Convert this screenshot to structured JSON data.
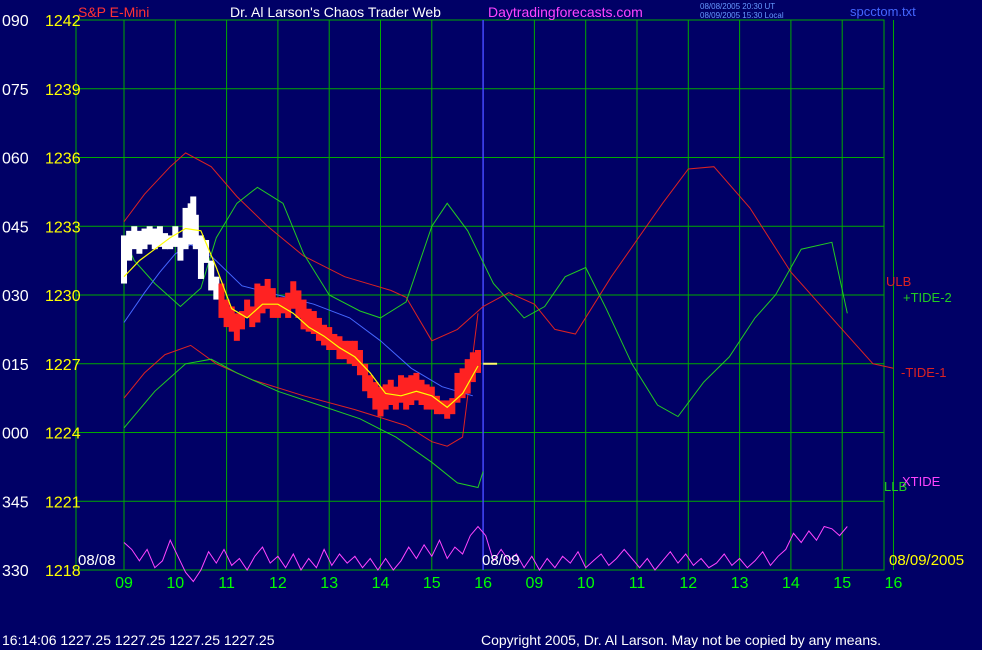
{
  "header": {
    "instrument": "S&P E-Mini",
    "title": "Dr. Al Larson's Chaos Trader Web",
    "site": "Daytradingforecasts.com",
    "timestamp_line1": "08/08/2005 20:30 UT",
    "timestamp_line2": "08/09/2005 15:30 Local",
    "filename": "spcctom.txt"
  },
  "status": {
    "time": "16:14:06",
    "ohlc": "1227.25 1227.25 1227.25 1227.25"
  },
  "copyright": "Copyright 2005, Dr. Al Larson. May not be copied by any means.",
  "colors": {
    "background": "#000066",
    "grid": "#00aa00",
    "price_tick": "#ffff00",
    "angle_tick": "#ffffff",
    "time_tick": "#00ff00",
    "title": "#ffffff",
    "instrument": "#ff3333",
    "site": "#ff44ff",
    "timestamp": "#6699ff",
    "ulb": "#dd2222",
    "tide2": "#22cc22",
    "tide1": "#dd2222",
    "xtide": "#ff44ff",
    "llb": "#22cc22",
    "price_bars": "#ff2222",
    "price_bars_early": "#ffffff",
    "moving_average": "#ffff00",
    "blue_line": "#4466ff",
    "date_marker": "#4444ff",
    "forecast_tick": "#ffff66"
  },
  "chart_data": {
    "type": "line",
    "yaxis_price": [
      "1242",
      "1239",
      "1236",
      "1233",
      "1230",
      "1227",
      "1224",
      "1221",
      "1218"
    ],
    "yaxis_angle": [
      "090",
      "075",
      "060",
      "045",
      "030",
      "015",
      "000",
      "345",
      "330"
    ],
    "price_range": [
      1218,
      1242
    ],
    "xaxis_hours": [
      "09",
      "10",
      "11",
      "12",
      "13",
      "14",
      "15",
      "16",
      "09",
      "10",
      "11",
      "12",
      "13",
      "14",
      "15",
      "16"
    ],
    "date_labels": [
      "08/08",
      "08/09",
      "08/09/2005"
    ],
    "grid": true,
    "series_labels": [
      "ULB",
      "+TIDE-2",
      "-TIDE-1",
      "XTIDE",
      "LLB"
    ],
    "ulb": [
      [
        0.0,
        1233.2
      ],
      [
        0.4,
        1234.4
      ],
      [
        0.9,
        1235.6
      ],
      [
        1.2,
        1236.2
      ],
      [
        1.7,
        1235.6
      ],
      [
        2.2,
        1234.3
      ],
      [
        2.8,
        1233.0
      ],
      [
        3.5,
        1231.7
      ],
      [
        4.3,
        1230.8
      ],
      [
        5.2,
        1230.2
      ],
      [
        5.5,
        1229.9
      ],
      [
        6.0,
        1228.0
      ],
      [
        6.5,
        1228.5
      ],
      [
        7.0,
        1229.5
      ],
      [
        7.5,
        1230.1
      ],
      [
        8.0,
        1229.6
      ],
      [
        8.4,
        1228.5
      ],
      [
        8.8,
        1228.3
      ],
      [
        9.5,
        1230.8
      ],
      [
        10.5,
        1234.0
      ],
      [
        11.0,
        1235.5
      ],
      [
        11.5,
        1235.6
      ],
      [
        12.2,
        1233.8
      ],
      [
        13.0,
        1231.0
      ],
      [
        14.0,
        1228.5
      ],
      [
        14.6,
        1227.0
      ],
      [
        15.0,
        1226.8
      ]
    ],
    "tide2": [
      [
        0.0,
        1232.5
      ],
      [
        0.2,
        1231.5
      ],
      [
        0.6,
        1230.5
      ],
      [
        1.1,
        1229.5
      ],
      [
        1.5,
        1230.3
      ],
      [
        1.8,
        1232.5
      ],
      [
        2.2,
        1234.0
      ],
      [
        2.6,
        1234.7
      ],
      [
        3.1,
        1234.0
      ],
      [
        3.5,
        1231.8
      ],
      [
        4.0,
        1230.0
      ],
      [
        4.6,
        1229.3
      ],
      [
        5.0,
        1229.0
      ],
      [
        5.5,
        1229.7
      ],
      [
        6.0,
        1233.0
      ],
      [
        6.3,
        1234.0
      ],
      [
        6.7,
        1232.8
      ],
      [
        7.2,
        1230.5
      ],
      [
        7.8,
        1229.0
      ],
      [
        8.2,
        1229.5
      ],
      [
        8.6,
        1230.8
      ],
      [
        9.0,
        1231.2
      ],
      [
        9.4,
        1229.4
      ],
      [
        9.9,
        1227.0
      ],
      [
        10.4,
        1225.2
      ],
      [
        10.8,
        1224.7
      ],
      [
        11.3,
        1226.2
      ],
      [
        11.8,
        1227.3
      ],
      [
        12.3,
        1229.0
      ],
      [
        12.7,
        1230.0
      ],
      [
        13.2,
        1232.0
      ],
      [
        13.8,
        1232.3
      ],
      [
        14.1,
        1229.2
      ]
    ],
    "tide1": [
      [
        0.0,
        1225.5
      ],
      [
        0.4,
        1226.6
      ],
      [
        0.8,
        1227.4
      ],
      [
        1.3,
        1227.8
      ],
      [
        1.8,
        1227.0
      ],
      [
        2.5,
        1226.3
      ],
      [
        3.5,
        1225.6
      ],
      [
        4.5,
        1225.0
      ],
      [
        5.5,
        1224.3
      ],
      [
        6.0,
        1223.6
      ],
      [
        6.3,
        1223.4
      ],
      [
        6.6,
        1223.8
      ],
      [
        6.9,
        1229.2
      ]
    ],
    "llb": [
      [
        0.0,
        1224.2
      ],
      [
        0.6,
        1225.8
      ],
      [
        1.2,
        1227.0
      ],
      [
        1.7,
        1227.2
      ],
      [
        2.2,
        1226.6
      ],
      [
        3.0,
        1225.8
      ],
      [
        3.8,
        1225.2
      ],
      [
        4.6,
        1224.6
      ],
      [
        5.3,
        1223.8
      ],
      [
        6.0,
        1222.7
      ],
      [
        6.5,
        1221.8
      ],
      [
        6.9,
        1221.6
      ],
      [
        7.0,
        1222.3
      ]
    ],
    "blue_line": [
      [
        0.0,
        1228.8
      ],
      [
        0.4,
        1230.1
      ],
      [
        0.7,
        1231.0
      ],
      [
        1.0,
        1231.8
      ],
      [
        1.3,
        1232.2
      ],
      [
        1.7,
        1231.7
      ],
      [
        2.3,
        1230.4
      ],
      [
        3.0,
        1230.0
      ],
      [
        3.7,
        1229.6
      ],
      [
        4.4,
        1229.0
      ],
      [
        5.0,
        1228.0
      ],
      [
        5.6,
        1226.8
      ],
      [
        6.2,
        1226.0
      ],
      [
        6.8,
        1225.6
      ]
    ],
    "moving_average": [
      [
        0.0,
        1230.8
      ],
      [
        0.3,
        1231.5
      ],
      [
        0.6,
        1232.0
      ],
      [
        0.9,
        1232.5
      ],
      [
        1.2,
        1232.9
      ],
      [
        1.5,
        1232.8
      ],
      [
        1.8,
        1231.2
      ],
      [
        2.1,
        1229.4
      ],
      [
        2.4,
        1229.0
      ],
      [
        2.7,
        1229.6
      ],
      [
        3.0,
        1229.6
      ],
      [
        3.3,
        1229.2
      ],
      [
        3.6,
        1228.6
      ],
      [
        3.9,
        1228.2
      ],
      [
        4.2,
        1227.7
      ],
      [
        4.5,
        1227.3
      ],
      [
        4.8,
        1226.6
      ],
      [
        5.1,
        1225.7
      ],
      [
        5.4,
        1225.6
      ],
      [
        5.7,
        1225.8
      ],
      [
        6.0,
        1225.6
      ],
      [
        6.3,
        1225.1
      ],
      [
        6.6,
        1225.7
      ],
      [
        6.9,
        1226.9
      ]
    ],
    "price_bars": [
      [
        0.0,
        1230.5,
        1232.6
      ],
      [
        0.1,
        1231.5,
        1232.8
      ],
      [
        0.2,
        1232.0,
        1233.0
      ],
      [
        0.3,
        1231.8,
        1232.8
      ],
      [
        0.4,
        1232.0,
        1232.9
      ],
      [
        0.5,
        1232.2,
        1233.0
      ],
      [
        0.6,
        1232.0,
        1232.9
      ],
      [
        0.7,
        1232.1,
        1233.0
      ],
      [
        0.8,
        1232.0,
        1232.7
      ],
      [
        0.9,
        1232.0,
        1232.6
      ],
      [
        1.0,
        1232.1,
        1233.0
      ],
      [
        1.1,
        1231.5,
        1232.5
      ],
      [
        1.2,
        1232.0,
        1233.8
      ],
      [
        1.3,
        1232.2,
        1234.0
      ],
      [
        1.35,
        1233.0,
        1234.3
      ],
      [
        1.4,
        1232.0,
        1233.5
      ],
      [
        1.5,
        1230.7,
        1232.6
      ],
      [
        1.6,
        1231.4,
        1232.4
      ],
      [
        1.7,
        1230.2,
        1231.5
      ],
      [
        1.8,
        1229.8,
        1230.8
      ],
      [
        1.9,
        1229.0,
        1230.5
      ],
      [
        2.0,
        1228.6,
        1229.8
      ],
      [
        2.1,
        1228.4,
        1229.5
      ],
      [
        2.2,
        1228.0,
        1229.2
      ],
      [
        2.3,
        1228.5,
        1229.3
      ],
      [
        2.4,
        1229.0,
        1229.8
      ],
      [
        2.5,
        1228.6,
        1229.5
      ],
      [
        2.6,
        1228.8,
        1230.5
      ],
      [
        2.7,
        1229.2,
        1230.4
      ],
      [
        2.8,
        1229.4,
        1230.7
      ],
      [
        2.9,
        1229.0,
        1230.3
      ],
      [
        3.0,
        1229.0,
        1229.9
      ],
      [
        3.1,
        1229.2,
        1229.9
      ],
      [
        3.2,
        1229.0,
        1230.1
      ],
      [
        3.3,
        1229.4,
        1230.6
      ],
      [
        3.4,
        1229.0,
        1230.2
      ],
      [
        3.5,
        1228.5,
        1229.8
      ],
      [
        3.6,
        1228.4,
        1229.4
      ],
      [
        3.7,
        1228.3,
        1229.3
      ],
      [
        3.8,
        1228.0,
        1229.0
      ],
      [
        3.9,
        1227.8,
        1228.7
      ],
      [
        4.0,
        1227.6,
        1228.6
      ],
      [
        4.1,
        1227.6,
        1228.3
      ],
      [
        4.2,
        1227.2,
        1228.2
      ],
      [
        4.3,
        1227.2,
        1228.0
      ],
      [
        4.4,
        1227.0,
        1228.0
      ],
      [
        4.5,
        1226.9,
        1228.0
      ],
      [
        4.6,
        1226.5,
        1227.6
      ],
      [
        4.7,
        1225.8,
        1227.0
      ],
      [
        4.8,
        1225.5,
        1226.5
      ],
      [
        4.9,
        1225.0,
        1226.2
      ],
      [
        5.0,
        1224.7,
        1226.0
      ],
      [
        5.1,
        1225.0,
        1226.1
      ],
      [
        5.2,
        1225.2,
        1226.3
      ],
      [
        5.3,
        1225.0,
        1226.0
      ],
      [
        5.4,
        1225.3,
        1226.5
      ],
      [
        5.5,
        1225.0,
        1226.4
      ],
      [
        5.6,
        1225.2,
        1226.5
      ],
      [
        5.7,
        1225.4,
        1226.6
      ],
      [
        5.8,
        1225.2,
        1226.3
      ],
      [
        5.9,
        1225.0,
        1226.1
      ],
      [
        6.0,
        1225.0,
        1226.0
      ],
      [
        6.1,
        1224.8,
        1225.6
      ],
      [
        6.2,
        1224.8,
        1225.4
      ],
      [
        6.3,
        1224.6,
        1225.4
      ],
      [
        6.4,
        1224.8,
        1225.5
      ],
      [
        6.5,
        1225.3,
        1226.6
      ],
      [
        6.6,
        1225.5,
        1226.8
      ],
      [
        6.7,
        1225.7,
        1227.2
      ],
      [
        6.8,
        1226.2,
        1227.5
      ],
      [
        6.9,
        1226.6,
        1227.6
      ]
    ],
    "xtide": [
      [
        0.0,
        1219.2
      ],
      [
        0.15,
        1218.9
      ],
      [
        0.3,
        1218.4
      ],
      [
        0.45,
        1218.9
      ],
      [
        0.6,
        1218.1
      ],
      [
        0.75,
        1218.4
      ],
      [
        0.9,
        1219.3
      ],
      [
        1.05,
        1218.6
      ],
      [
        1.2,
        1217.9
      ],
      [
        1.35,
        1217.5
      ],
      [
        1.5,
        1218.0
      ],
      [
        1.65,
        1218.8
      ],
      [
        1.8,
        1218.3
      ],
      [
        1.95,
        1218.9
      ],
      [
        2.1,
        1218.2
      ],
      [
        2.25,
        1218.5
      ],
      [
        2.4,
        1218.0
      ],
      [
        2.55,
        1218.6
      ],
      [
        2.7,
        1219.0
      ],
      [
        2.85,
        1218.3
      ],
      [
        3.0,
        1218.6
      ],
      [
        3.15,
        1218.1
      ],
      [
        3.3,
        1218.7
      ],
      [
        3.45,
        1218.0
      ],
      [
        3.6,
        1218.5
      ],
      [
        3.75,
        1218.1
      ],
      [
        3.9,
        1218.9
      ],
      [
        4.05,
        1218.2
      ],
      [
        4.2,
        1218.7
      ],
      [
        4.35,
        1218.3
      ],
      [
        4.5,
        1218.6
      ],
      [
        4.65,
        1218.1
      ],
      [
        4.8,
        1218.5
      ],
      [
        4.95,
        1218.0
      ],
      [
        5.1,
        1218.5
      ],
      [
        5.25,
        1218.0
      ],
      [
        5.4,
        1218.4
      ],
      [
        5.55,
        1219.0
      ],
      [
        5.7,
        1218.5
      ],
      [
        5.85,
        1219.1
      ],
      [
        6.0,
        1218.6
      ],
      [
        6.15,
        1219.3
      ],
      [
        6.3,
        1218.5
      ],
      [
        6.45,
        1219.0
      ],
      [
        6.6,
        1218.7
      ],
      [
        6.75,
        1219.5
      ],
      [
        6.9,
        1219.9
      ],
      [
        7.05,
        1219.5
      ],
      [
        7.2,
        1218.4
      ],
      [
        7.35,
        1218.9
      ],
      [
        7.5,
        1218.4
      ],
      [
        7.65,
        1218.7
      ],
      [
        7.8,
        1218.1
      ],
      [
        7.95,
        1218.6
      ],
      [
        8.1,
        1218.0
      ],
      [
        8.25,
        1218.5
      ],
      [
        8.4,
        1218.1
      ],
      [
        8.55,
        1218.6
      ],
      [
        8.7,
        1218.3
      ],
      [
        8.85,
        1218.8
      ],
      [
        9.0,
        1218.1
      ],
      [
        9.15,
        1218.4
      ],
      [
        9.3,
        1218.7
      ],
      [
        9.45,
        1218.2
      ],
      [
        9.6,
        1218.5
      ],
      [
        9.75,
        1218.9
      ],
      [
        9.9,
        1218.5
      ],
      [
        10.05,
        1218.1
      ],
      [
        10.2,
        1218.5
      ],
      [
        10.35,
        1218.0
      ],
      [
        10.5,
        1218.4
      ],
      [
        10.65,
        1218.8
      ],
      [
        10.8,
        1218.3
      ],
      [
        10.95,
        1218.7
      ],
      [
        11.1,
        1218.2
      ],
      [
        11.25,
        1218.5
      ],
      [
        11.4,
        1218.1
      ],
      [
        11.55,
        1218.3
      ],
      [
        11.7,
        1218.7
      ],
      [
        11.85,
        1218.2
      ],
      [
        12.0,
        1218.5
      ],
      [
        12.15,
        1218.1
      ],
      [
        12.3,
        1218.4
      ],
      [
        12.45,
        1218.8
      ],
      [
        12.6,
        1218.2
      ],
      [
        12.75,
        1218.6
      ],
      [
        12.9,
        1218.9
      ],
      [
        13.05,
        1219.6
      ],
      [
        13.2,
        1219.2
      ],
      [
        13.35,
        1219.7
      ],
      [
        13.5,
        1219.3
      ],
      [
        13.65,
        1219.9
      ],
      [
        13.8,
        1219.8
      ],
      [
        13.95,
        1219.5
      ],
      [
        14.1,
        1219.9
      ]
    ]
  }
}
